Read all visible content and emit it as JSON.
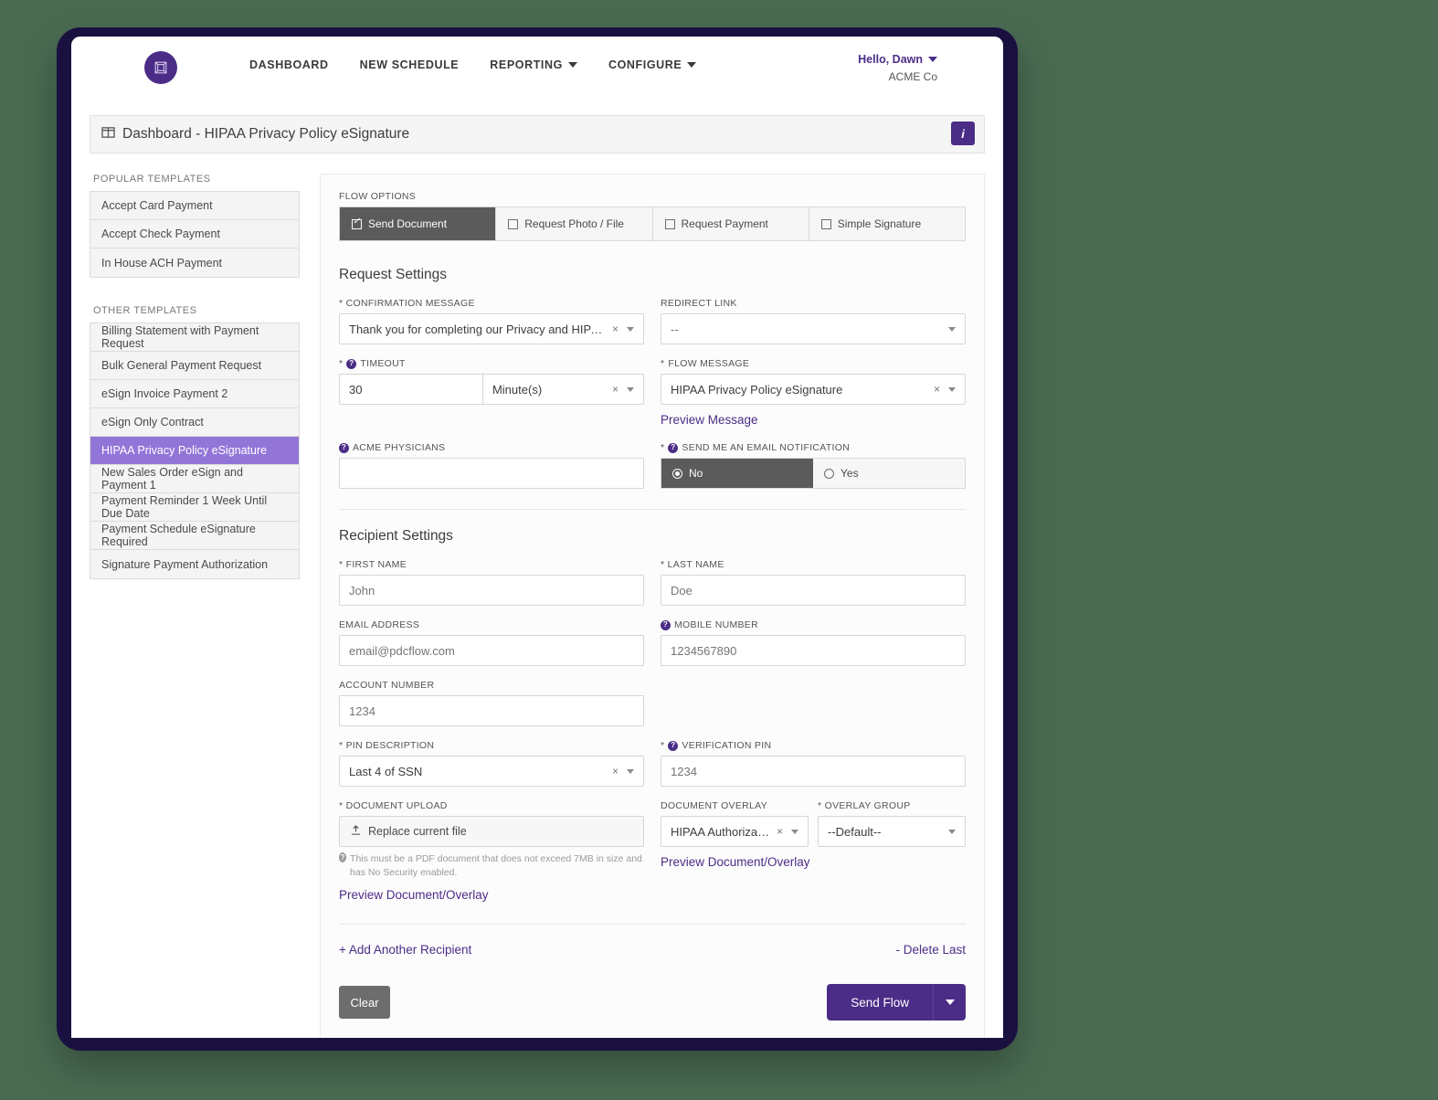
{
  "nav": {
    "logo_icon": "cube-logo-icon",
    "links": [
      {
        "label": "DASHBOARD",
        "has_caret": false
      },
      {
        "label": "NEW SCHEDULE",
        "has_caret": false
      },
      {
        "label": "REPORTING",
        "has_caret": true
      },
      {
        "label": "CONFIGURE",
        "has_caret": true
      }
    ],
    "user_greeting": "Hello, Dawn",
    "company": "ACME Co"
  },
  "page_title": {
    "icon": "columns-layout-icon",
    "text": "Dashboard - HIPAA Privacy Policy eSignature",
    "info_button": "i"
  },
  "sidebar": {
    "popular_heading": "POPULAR TEMPLATES",
    "popular_items": [
      {
        "label": "Accept Card Payment"
      },
      {
        "label": "Accept Check Payment"
      },
      {
        "label": "In House ACH Payment"
      }
    ],
    "other_heading": "OTHER TEMPLATES",
    "other_items": [
      {
        "label": "Billing Statement with Payment Request",
        "active": false
      },
      {
        "label": "Bulk General Payment Request",
        "active": false
      },
      {
        "label": "eSign Invoice Payment 2",
        "active": false
      },
      {
        "label": "eSign Only Contract",
        "active": false
      },
      {
        "label": "HIPAA Privacy Policy eSignature",
        "active": true
      },
      {
        "label": "New Sales Order eSign and Payment 1",
        "active": false
      },
      {
        "label": "Payment Reminder 1 Week Until Due Date",
        "active": false
      },
      {
        "label": "Payment Schedule eSignature Required",
        "active": false
      },
      {
        "label": "Signature Payment Authorization",
        "active": false
      }
    ],
    "active_color": "#9375d8"
  },
  "flow_options": {
    "heading": "FLOW OPTIONS",
    "tabs": [
      {
        "label": "Send Document",
        "active": true
      },
      {
        "label": "Request Photo / File",
        "active": false
      },
      {
        "label": "Request Payment",
        "active": false
      },
      {
        "label": "Simple Signature",
        "active": false
      }
    ]
  },
  "request_settings": {
    "title": "Request Settings",
    "confirmation_message": {
      "label": "* CONFIRMATION MESSAGE",
      "value": "Thank you for completing our Privacy and HIPAA ..."
    },
    "redirect_link": {
      "label": "REDIRECT LINK",
      "value": "--"
    },
    "timeout": {
      "label": "TIMEOUT",
      "required": "*",
      "value": "30",
      "unit": "Minute(s)"
    },
    "flow_message": {
      "label": "FLOW MESSAGE",
      "required": "*",
      "value": "HIPAA Privacy Policy eSignature",
      "preview_link": "Preview Message"
    },
    "acme_physicians": {
      "label": "ACME PHYSICIANS",
      "value": ""
    },
    "email_notification": {
      "label": "SEND ME AN EMAIL NOTIFICATION",
      "required": "*",
      "options": [
        {
          "label": "No",
          "selected": true
        },
        {
          "label": "Yes",
          "selected": false
        }
      ]
    }
  },
  "recipient_settings": {
    "title": "Recipient Settings",
    "first_name": {
      "label": "* FIRST NAME",
      "placeholder": "John",
      "value": ""
    },
    "last_name": {
      "label": "* LAST NAME",
      "placeholder": "Doe",
      "value": ""
    },
    "email_address": {
      "label": "EMAIL ADDRESS",
      "placeholder": "email@pdcflow.com",
      "value": ""
    },
    "mobile_number": {
      "label": "MOBILE NUMBER",
      "placeholder": "1234567890",
      "value": ""
    },
    "account_number": {
      "label": "ACCOUNT NUMBER",
      "placeholder": "1234",
      "value": ""
    },
    "pin_description": {
      "label": "* PIN DESCRIPTION",
      "value": "Last 4 of SSN"
    },
    "verification_pin": {
      "label": "VERIFICATION PIN",
      "required": "*",
      "placeholder": "1234",
      "value": ""
    },
    "document_upload": {
      "label": "* DOCUMENT UPLOAD",
      "button_label": "Replace current file",
      "hint": "This must be a PDF document that does not exceed 7MB in size and has No Security enabled.",
      "preview_link": "Preview Document/Overlay"
    },
    "document_overlay": {
      "label": "DOCUMENT OVERLAY",
      "value": "HIPAA Authorizatio...",
      "preview_link": "Preview Document/Overlay"
    },
    "overlay_group": {
      "label": "* OVERLAY GROUP",
      "value": "--Default--"
    },
    "add_recipient": "+ Add Another Recipient",
    "delete_last": "- Delete Last"
  },
  "actions": {
    "clear": "Clear",
    "send_flow": "Send Flow"
  },
  "colors": {
    "brand_purple": "#4b2d87",
    "highlight_purple": "#9375d8",
    "frame_navy": "#1a1040",
    "page_background": "#4a6b52",
    "tab_active": "#5b5b5b"
  }
}
